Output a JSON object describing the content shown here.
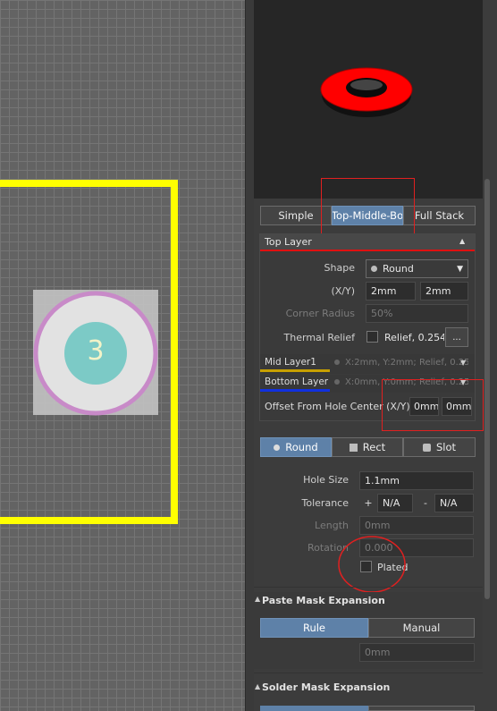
{
  "canvas": {
    "pad_number": "3"
  },
  "view_tabs": [
    "Simple",
    "Top-Middle-Bo",
    "Full Stack"
  ],
  "layer_panel": {
    "title": "Top Layer",
    "collapse_glyph": "▲",
    "shape_label": "Shape",
    "shape_value": "Round",
    "xy_label": "(X/Y)",
    "x_value": "2mm",
    "y_value": "2mm",
    "corner_radius_label": "Corner Radius",
    "corner_radius_value": "50%",
    "thermal_relief_label": "Thermal Relief",
    "thermal_relief_value": "Relief, 0.254r",
    "thermal_relief_more": "...",
    "mid_layer_label": "Mid Layer1",
    "mid_layer_value": "X:2mm, Y:2mm; Relief, 0.25",
    "bottom_layer_label": "Bottom Layer",
    "bottom_layer_value": "X:0mm, Y:0mm; Relief, 0.25",
    "offset_label": "Offset From Hole Center (X/Y)",
    "offset_x": "0mm",
    "offset_y": "0mm"
  },
  "hole": {
    "types": [
      "Round",
      "Rect",
      "Slot"
    ],
    "hole_size_label": "Hole Size",
    "hole_size_value": "1.1mm",
    "tolerance_label": "Tolerance",
    "tol_plus": "+",
    "tol_plus_value": "N/A",
    "tol_minus": "-",
    "tol_minus_value": "N/A",
    "length_label": "Length",
    "length_value": "0mm",
    "rotation_label": "Rotation",
    "rotation_value": "0.000",
    "plated_label": "Plated"
  },
  "paste_mask": {
    "title": "Paste Mask Expansion",
    "rule_label": "Rule",
    "manual_label": "Manual",
    "value": "0mm"
  },
  "solder_mask": {
    "title": "Solder Mask Expansion"
  },
  "colors": {
    "accent_selected": "#5e81a8",
    "top_layer": "#e01010",
    "mid_layer": "#c8a000",
    "bottom_layer": "#1030e0",
    "annotation": "#e02020",
    "pad_outline": "#ffff00"
  }
}
